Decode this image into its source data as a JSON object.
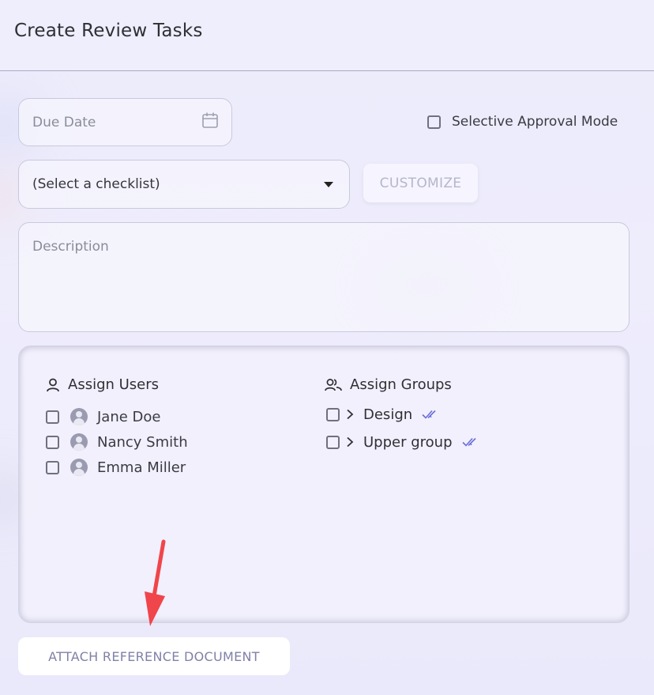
{
  "header": {
    "title": "Create Review Tasks"
  },
  "form": {
    "due_date": {
      "placeholder": "Due Date",
      "icon": "calendar-icon"
    },
    "selective_approval": {
      "label": "Selective Approval Mode",
      "checked": false
    },
    "checklist": {
      "selected": "(Select a checklist)"
    },
    "customize_label": "CUSTOMIZE",
    "description": {
      "placeholder": "Description"
    }
  },
  "assign": {
    "users": {
      "title": "Assign Users",
      "icon": "user-icon",
      "items": [
        {
          "name": "Jane Doe",
          "checked": false
        },
        {
          "name": "Nancy Smith",
          "checked": false
        },
        {
          "name": "Emma Miller",
          "checked": false
        }
      ]
    },
    "groups": {
      "title": "Assign Groups",
      "icon": "users-group-icon",
      "items": [
        {
          "name": "Design",
          "checked": false
        },
        {
          "name": "Upper group",
          "checked": false
        }
      ]
    }
  },
  "attach_label": "ATTACH REFERENCE DOCUMENT",
  "colors": {
    "accent_check": "#6b6fd6",
    "annotation_arrow": "#f0454b",
    "muted_button_text": "#b4b6cc",
    "link_button_text": "#7f81a8"
  }
}
